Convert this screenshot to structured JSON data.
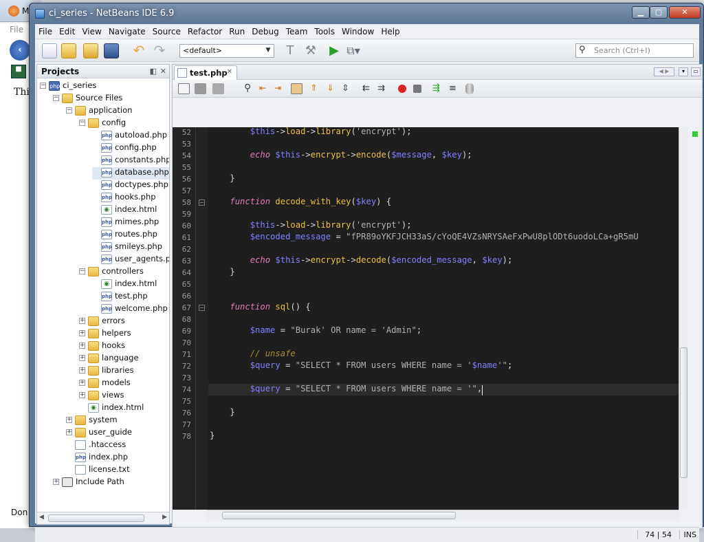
{
  "window": {
    "title": "ci_series - NetBeans IDE 6.9",
    "minimize": "▁",
    "maximize": "▢",
    "close": "✕"
  },
  "background": {
    "tab_label": "M",
    "file_label": "File",
    "body_text": "Thi",
    "status": "Don"
  },
  "menu": [
    "File",
    "Edit",
    "View",
    "Navigate",
    "Source",
    "Refactor",
    "Run",
    "Debug",
    "Team",
    "Tools",
    "Window",
    "Help"
  ],
  "toolbar": {
    "config_value": "<default>",
    "search_placeholder": "Search (Ctrl+I)"
  },
  "projects": {
    "title": "Projects",
    "nodes": [
      {
        "label": "ci_series",
        "depth": 0,
        "type": "phpproj",
        "exp": "−"
      },
      {
        "label": "Source Files",
        "depth": 1,
        "type": "srcfold",
        "exp": "−"
      },
      {
        "label": "application",
        "depth": 2,
        "type": "folder",
        "exp": "−"
      },
      {
        "label": "config",
        "depth": 3,
        "type": "folder",
        "exp": "−"
      },
      {
        "label": "autoload.php",
        "depth": 4,
        "type": "filephp"
      },
      {
        "label": "config.php",
        "depth": 4,
        "type": "filephp"
      },
      {
        "label": "constants.php",
        "depth": 4,
        "type": "filephp"
      },
      {
        "label": "database.php",
        "depth": 4,
        "type": "filephp",
        "selected": true
      },
      {
        "label": "doctypes.php",
        "depth": 4,
        "type": "filephp"
      },
      {
        "label": "hooks.php",
        "depth": 4,
        "type": "filephp"
      },
      {
        "label": "index.html",
        "depth": 4,
        "type": "filehtml"
      },
      {
        "label": "mimes.php",
        "depth": 4,
        "type": "filephp"
      },
      {
        "label": "routes.php",
        "depth": 4,
        "type": "filephp"
      },
      {
        "label": "smileys.php",
        "depth": 4,
        "type": "filephp"
      },
      {
        "label": "user_agents.ph",
        "depth": 4,
        "type": "filephp"
      },
      {
        "label": "controllers",
        "depth": 3,
        "type": "folder",
        "exp": "−"
      },
      {
        "label": "index.html",
        "depth": 4,
        "type": "filehtml"
      },
      {
        "label": "test.php",
        "depth": 4,
        "type": "filephp"
      },
      {
        "label": "welcome.php",
        "depth": 4,
        "type": "filephp"
      },
      {
        "label": "errors",
        "depth": 3,
        "type": "folder",
        "exp": "+"
      },
      {
        "label": "helpers",
        "depth": 3,
        "type": "folder",
        "exp": "+"
      },
      {
        "label": "hooks",
        "depth": 3,
        "type": "folder",
        "exp": "+"
      },
      {
        "label": "language",
        "depth": 3,
        "type": "folder",
        "exp": "+"
      },
      {
        "label": "libraries",
        "depth": 3,
        "type": "folder",
        "exp": "+"
      },
      {
        "label": "models",
        "depth": 3,
        "type": "folder",
        "exp": "+"
      },
      {
        "label": "views",
        "depth": 3,
        "type": "folder",
        "exp": "+"
      },
      {
        "label": "index.html",
        "depth": 3,
        "type": "filehtml"
      },
      {
        "label": "system",
        "depth": 2,
        "type": "folder",
        "exp": "+"
      },
      {
        "label": "user_guide",
        "depth": 2,
        "type": "folder",
        "exp": "+"
      },
      {
        "label": ".htaccess",
        "depth": 2,
        "type": "filetxt"
      },
      {
        "label": "index.php",
        "depth": 2,
        "type": "filephp"
      },
      {
        "label": "license.txt",
        "depth": 2,
        "type": "filetxt"
      },
      {
        "label": "Include Path",
        "depth": 1,
        "type": "lib",
        "exp": "+"
      }
    ]
  },
  "editor": {
    "tab_label": "test.php",
    "lines": [
      {
        "n": "52",
        "html": "        <span class='vr'>$this</span>-><span class='fn'>load</span>-><span class='fn'>library</span>(<span class='st'>'encrypt'</span>);"
      },
      {
        "n": "53",
        "html": ""
      },
      {
        "n": "54",
        "html": "        <span class='kw'>echo</span> <span class='vr'>$this</span>-><span class='fn'>encrypt</span>-><span class='fn'>encode</span>(<span class='vr'>$message</span>, <span class='vr'>$key</span>);"
      },
      {
        "n": "55",
        "html": ""
      },
      {
        "n": "56",
        "html": "    }"
      },
      {
        "n": "57",
        "html": ""
      },
      {
        "n": "58",
        "html": "    <span class='kw'>function</span> <span class='fn'>decode_with_key</span>(<span class='vr'>$key</span>) {",
        "fold": "−"
      },
      {
        "n": "59",
        "html": ""
      },
      {
        "n": "60",
        "html": "        <span class='vr'>$this</span>-><span class='fn'>load</span>-><span class='fn'>library</span>(<span class='st'>'encrypt'</span>);"
      },
      {
        "n": "61",
        "html": "        <span class='vr'>$encoded_message</span> = <span class='st'>\"fPR89oYKFJCH33aS/cYoQE4VZsNRYSAeFxPwU8plODt6uodoLCa+gR5mU</span>"
      },
      {
        "n": "62",
        "html": ""
      },
      {
        "n": "63",
        "html": "        <span class='kw'>echo</span> <span class='vr'>$this</span>-><span class='fn'>encrypt</span>-><span class='fn'>decode</span>(<span class='vr'>$encoded_message</span>, <span class='vr'>$key</span>);"
      },
      {
        "n": "64",
        "html": "    }"
      },
      {
        "n": "65",
        "html": ""
      },
      {
        "n": "66",
        "html": ""
      },
      {
        "n": "67",
        "html": "    <span class='kw'>function</span> <span class='fn'>sql</span>() {",
        "fold": "−"
      },
      {
        "n": "68",
        "html": ""
      },
      {
        "n": "69",
        "html": "        <span class='vr'>$name</span> = <span class='st'>\"Burak' OR name = 'Admin\"</span>;"
      },
      {
        "n": "70",
        "html": ""
      },
      {
        "n": "71",
        "html": "        <span class='cm'>// unsafe</span>"
      },
      {
        "n": "72",
        "html": "        <span class='vr'>$query</span> = <span class='st'>\"SELECT * FROM users WHERE name = '</span><span class='vr'>$name</span><span class='st'>'\"</span>;"
      },
      {
        "n": "73",
        "html": ""
      },
      {
        "n": "74",
        "html": "        <span class='vr'>$query</span> = <span class='st'>\"SELECT * FROM users WHERE name = '\"</span>,",
        "current": true
      },
      {
        "n": "75",
        "html": ""
      },
      {
        "n": "76",
        "html": "    }"
      },
      {
        "n": "77",
        "html": ""
      },
      {
        "n": "78",
        "html": "}"
      }
    ]
  },
  "status": {
    "position": "74 | 54",
    "mode": "INS"
  }
}
